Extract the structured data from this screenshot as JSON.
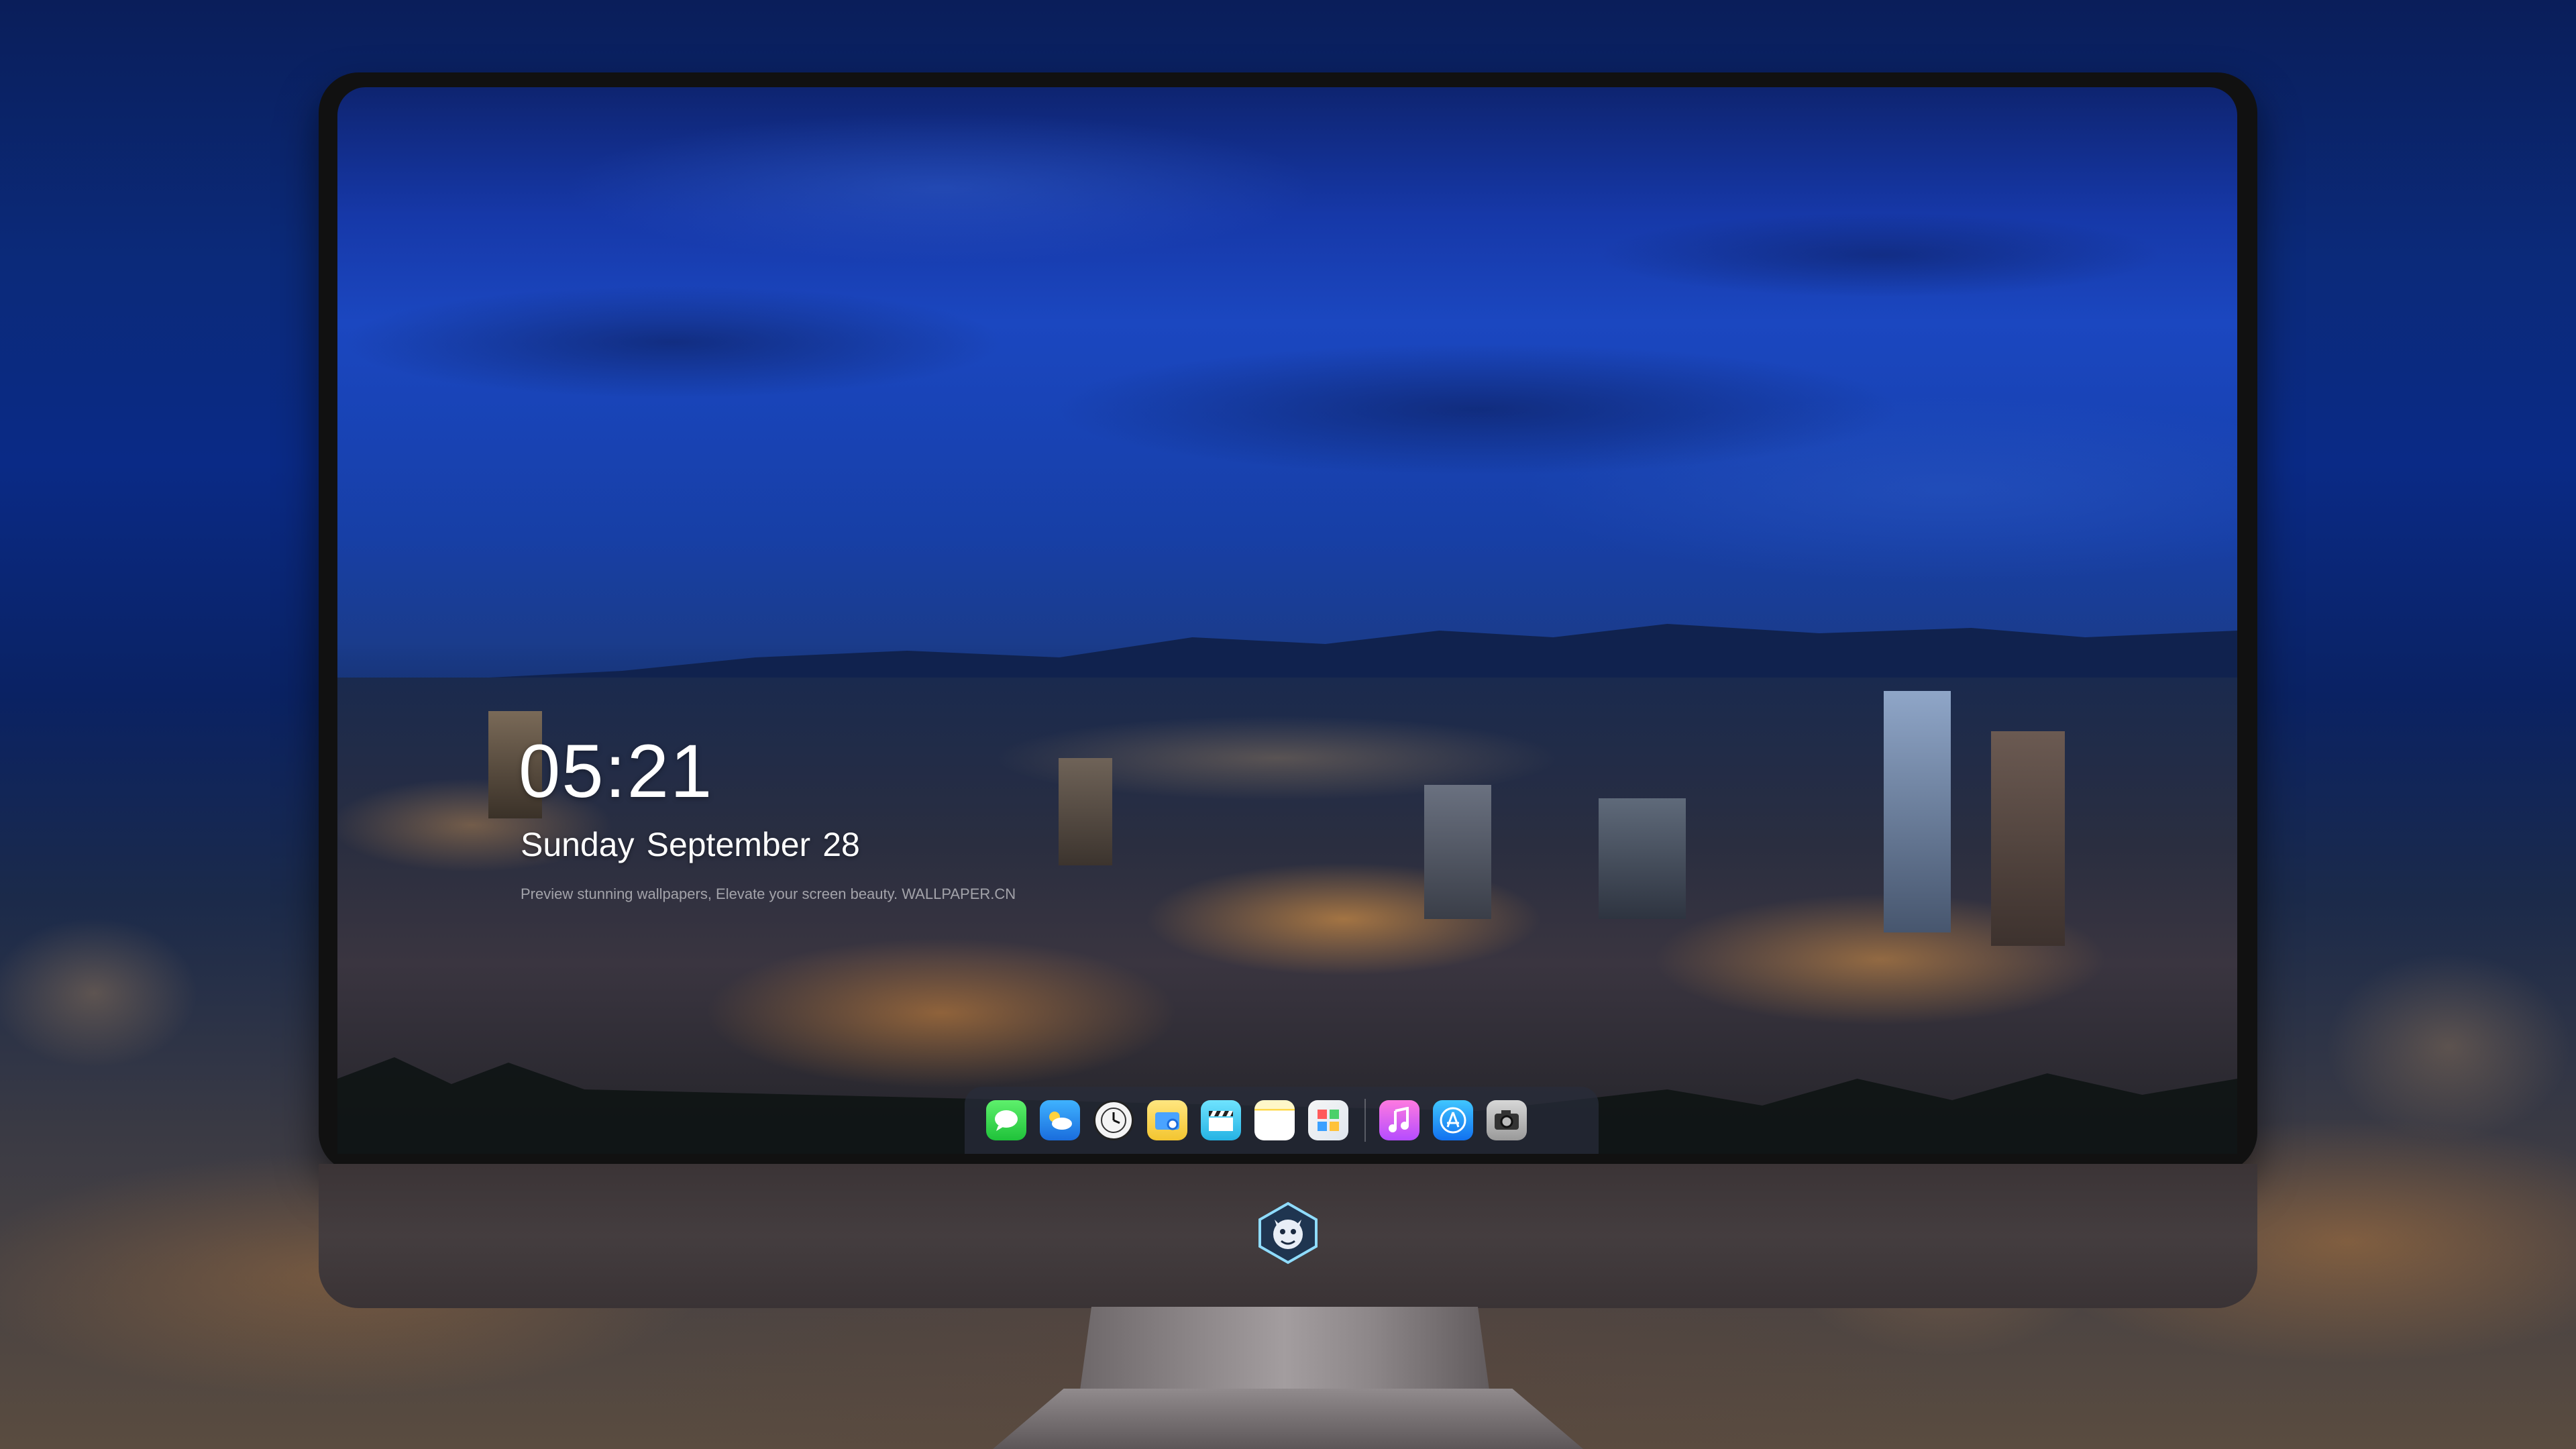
{
  "lockscreen": {
    "time": "05:21",
    "weekday": "Sunday",
    "month": "September",
    "day": "28",
    "tagline": "Preview stunning wallpapers, Elevate your screen beauty. WALLPAPER.CN"
  },
  "dock": {
    "apps": [
      {
        "name": "messages-icon",
        "glyph": "💬"
      },
      {
        "name": "weather-icon",
        "glyph": "☁"
      },
      {
        "name": "clock-icon",
        "glyph": "🕐"
      },
      {
        "name": "finder-icon",
        "glyph": "🗂"
      },
      {
        "name": "clapperboard-icon",
        "glyph": "🎬"
      },
      {
        "name": "notes-icon",
        "glyph": ""
      },
      {
        "name": "photos-icon",
        "glyph": "▦"
      },
      {
        "name": "music-icon",
        "glyph": "♫"
      },
      {
        "name": "app-store-icon",
        "glyph": "A"
      },
      {
        "name": "camera-icon",
        "glyph": "📷"
      }
    ]
  },
  "colors": {
    "sky_top": "#0e2470",
    "sky_mid": "#1b47c0",
    "city_glow": "#ffaa46"
  }
}
